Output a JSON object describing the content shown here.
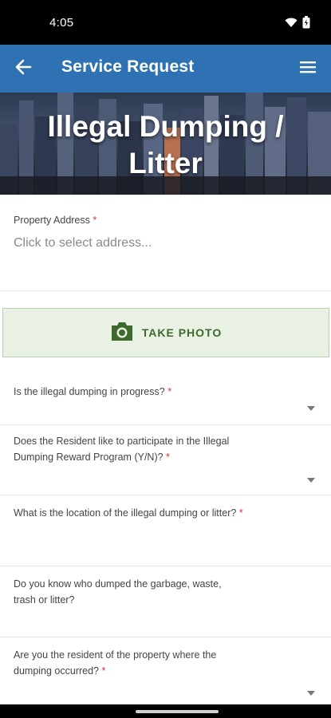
{
  "status_bar": {
    "time": "4:05",
    "icons": [
      "wifi-icon",
      "battery-icon"
    ]
  },
  "app_bar": {
    "title": "Service Request",
    "back_icon": "arrow-left-icon",
    "menu_icon": "hamburger-menu-icon",
    "background_color": "#2f72b3"
  },
  "hero": {
    "title_line1": "Illegal Dumping /",
    "title_line2": "Litter"
  },
  "form": {
    "address": {
      "label": "Property Address",
      "required_mark": "*",
      "placeholder": "Click to select address..."
    },
    "photo_button": {
      "label": "TAKE PHOTO",
      "icon": "camera-icon",
      "color": "#3d6a2c"
    },
    "questions": [
      {
        "label": "Is the illegal dumping in progress?",
        "required_mark": "*"
      },
      {
        "label": "Does the Resident like to participate in the Illegal Dumping Reward Program (Y/N)?",
        "required_mark": "*"
      },
      {
        "label": "What is the location of the illegal dumping or litter?",
        "required_mark": "*"
      },
      {
        "label": "Do you know who dumped the garbage, waste, trash or litter?",
        "required_mark": ""
      },
      {
        "label": "Are you the resident of the property where the dumping occurred?",
        "required_mark": "*"
      }
    ]
  }
}
